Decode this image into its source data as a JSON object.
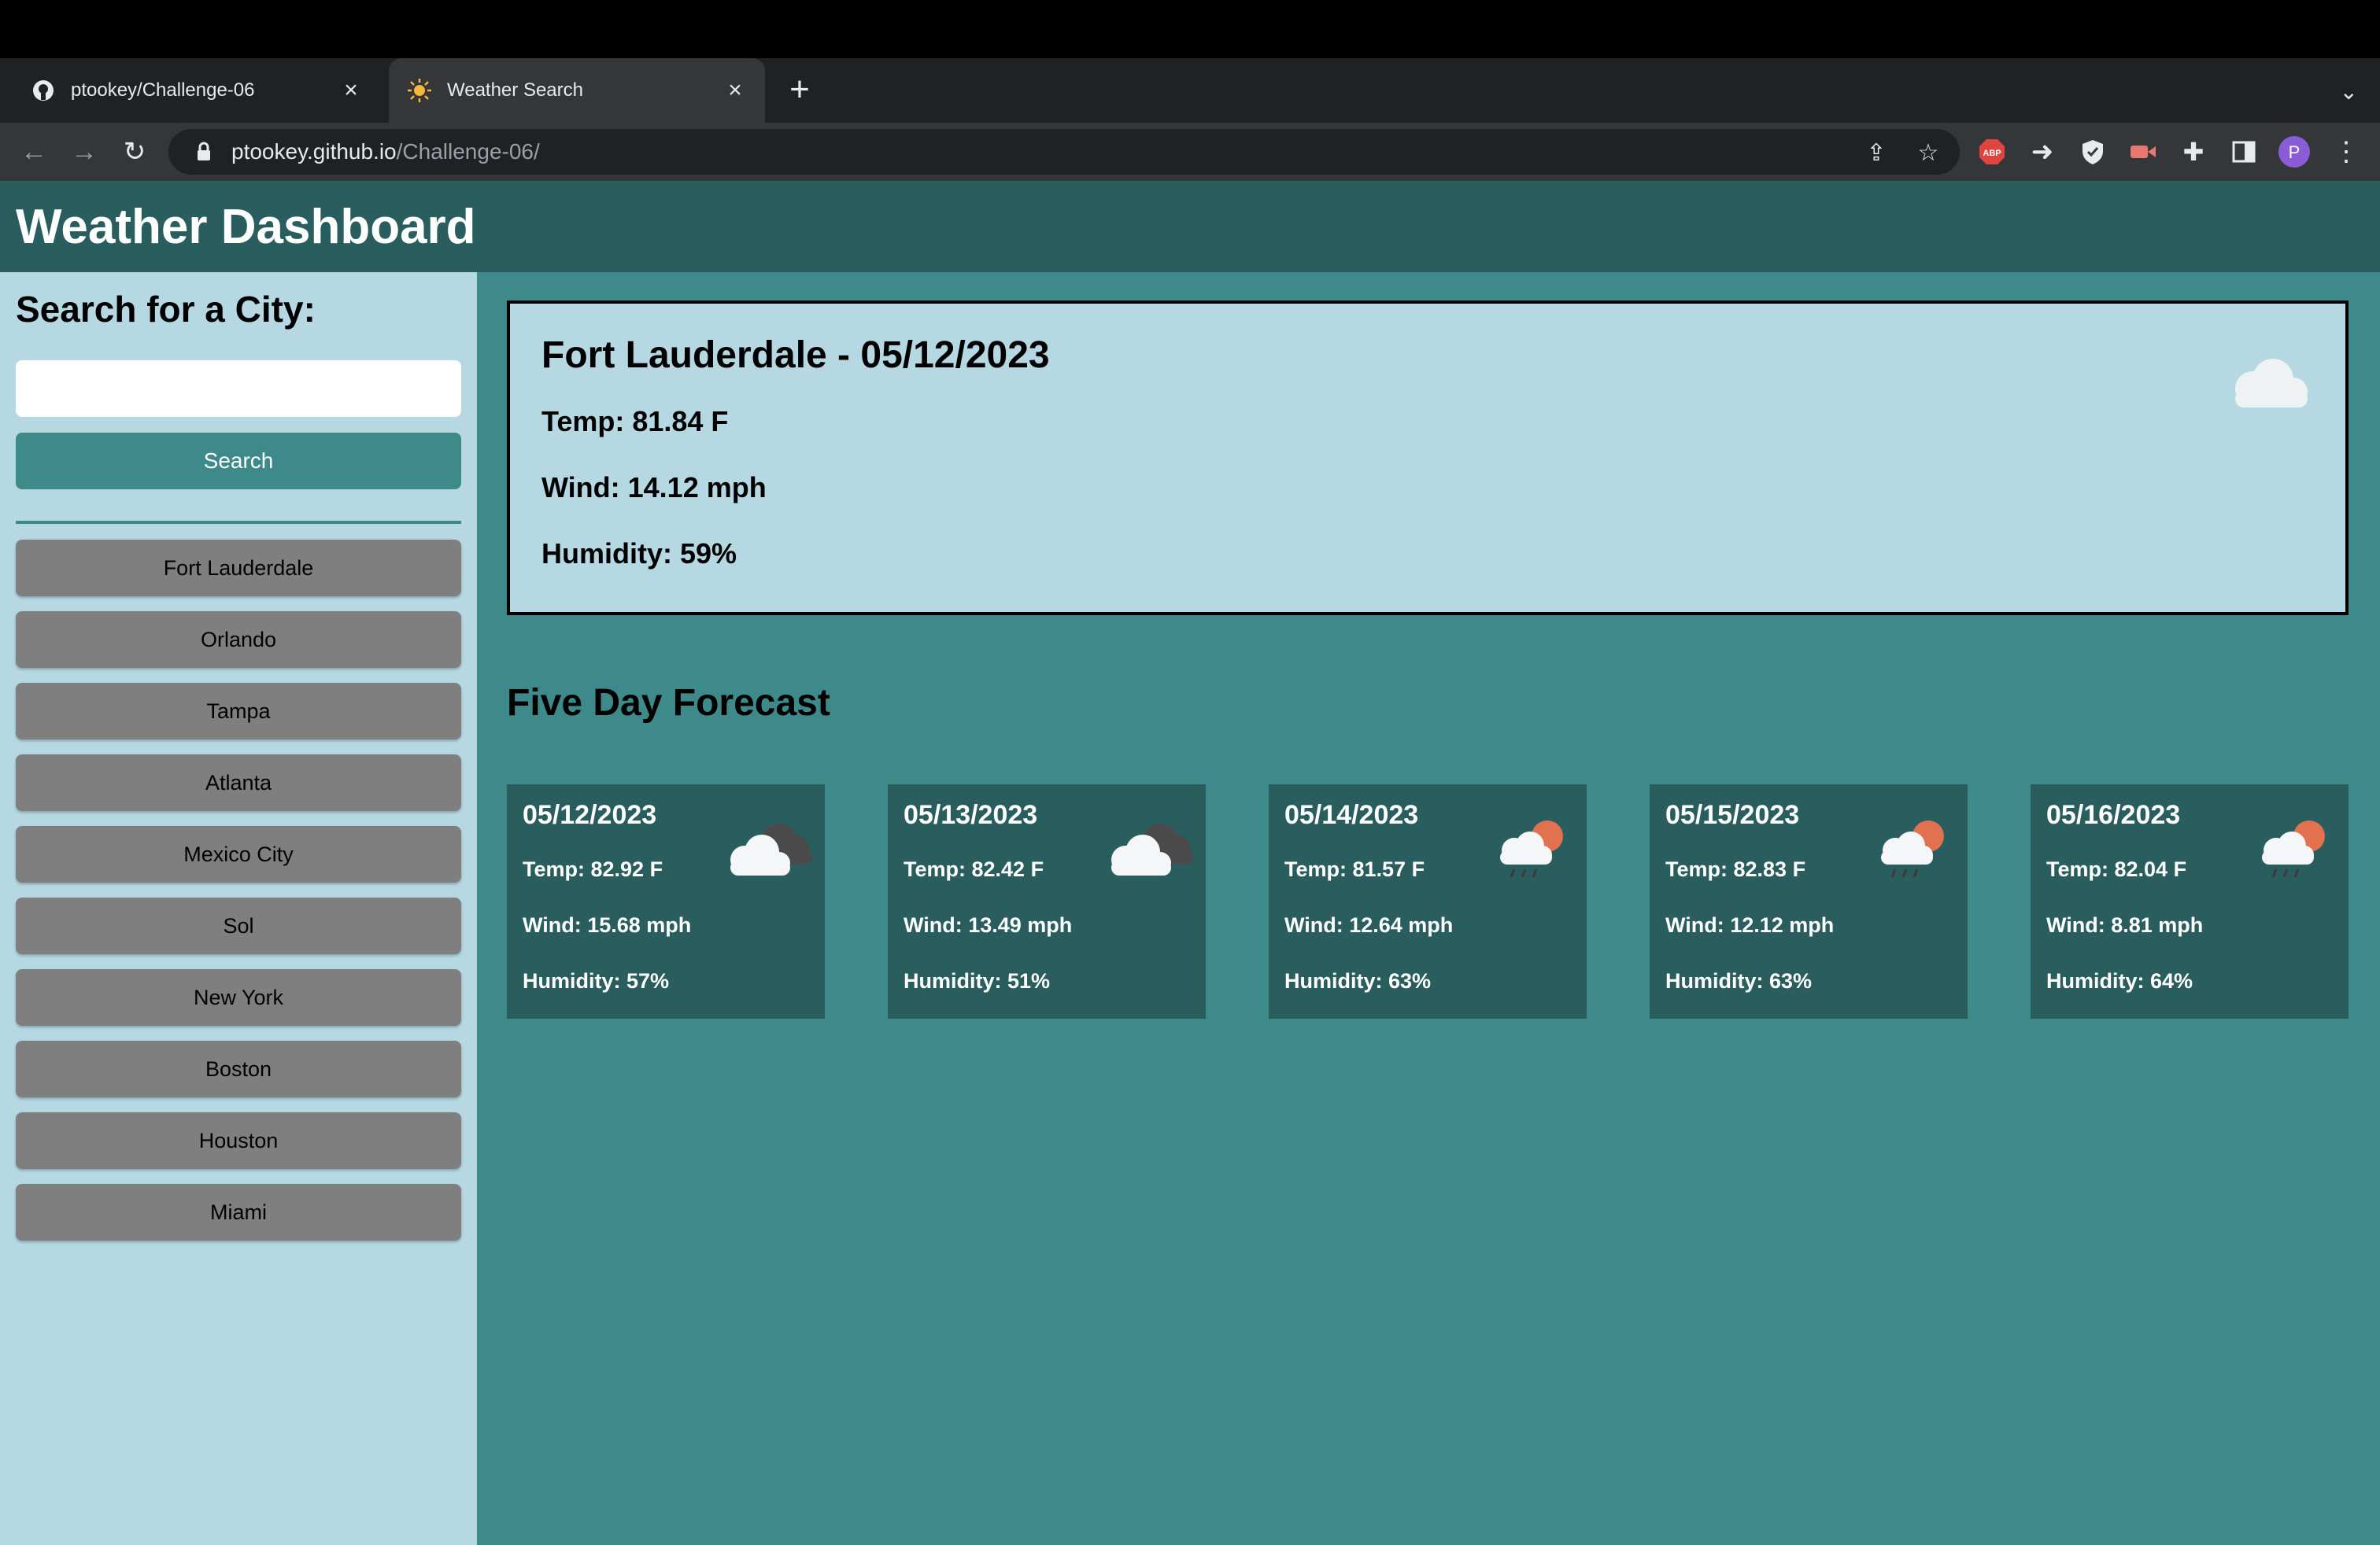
{
  "browser": {
    "tabs": [
      {
        "title": "ptookey/Challenge-06",
        "favicon": "github-icon",
        "active": false
      },
      {
        "title": "Weather Search",
        "favicon": "sun-icon",
        "active": true
      }
    ],
    "url_host": "ptookey.github.io",
    "url_path": "/Challenge-06/",
    "profile_initial": "P"
  },
  "header": {
    "title": "Weather Dashboard"
  },
  "sidebar": {
    "heading": "Search for a City:",
    "search_placeholder": "",
    "search_button": "Search",
    "history": [
      "Fort Lauderdale",
      "Orlando",
      "Tampa",
      "Atlanta",
      "Mexico City",
      "Sol",
      "New York",
      "Boston",
      "Houston",
      "Miami"
    ]
  },
  "current": {
    "heading": "Fort Lauderdale - 05/12/2023",
    "temp": "Temp: 81.84 F",
    "wind": "Wind: 14.12 mph",
    "humidity": "Humidity: 59%",
    "icon": "cloud-icon"
  },
  "forecast": {
    "title": "Five Day Forecast",
    "days": [
      {
        "date": "05/12/2023",
        "temp": "Temp: 82.92 F",
        "wind": "Wind: 15.68 mph",
        "humidity": "Humidity: 57%",
        "icon": "broken-clouds-icon"
      },
      {
        "date": "05/13/2023",
        "temp": "Temp: 82.42 F",
        "wind": "Wind: 13.49 mph",
        "humidity": "Humidity: 51%",
        "icon": "broken-clouds-icon"
      },
      {
        "date": "05/14/2023",
        "temp": "Temp: 81.57 F",
        "wind": "Wind: 12.64 mph",
        "humidity": "Humidity: 63%",
        "icon": "sun-rain-icon"
      },
      {
        "date": "05/15/2023",
        "temp": "Temp: 82.83 F",
        "wind": "Wind: 12.12 mph",
        "humidity": "Humidity: 63%",
        "icon": "sun-rain-icon"
      },
      {
        "date": "05/16/2023",
        "temp": "Temp: 82.04 F",
        "wind": "Wind: 8.81 mph",
        "humidity": "Humidity: 64%",
        "icon": "sun-rain-icon"
      }
    ]
  },
  "colors": {
    "header_bg": "#2a5e5e",
    "page_bg": "#3e8a8a",
    "sidebar_bg": "#b5d8e3",
    "history_button": "#7f7f7f"
  }
}
